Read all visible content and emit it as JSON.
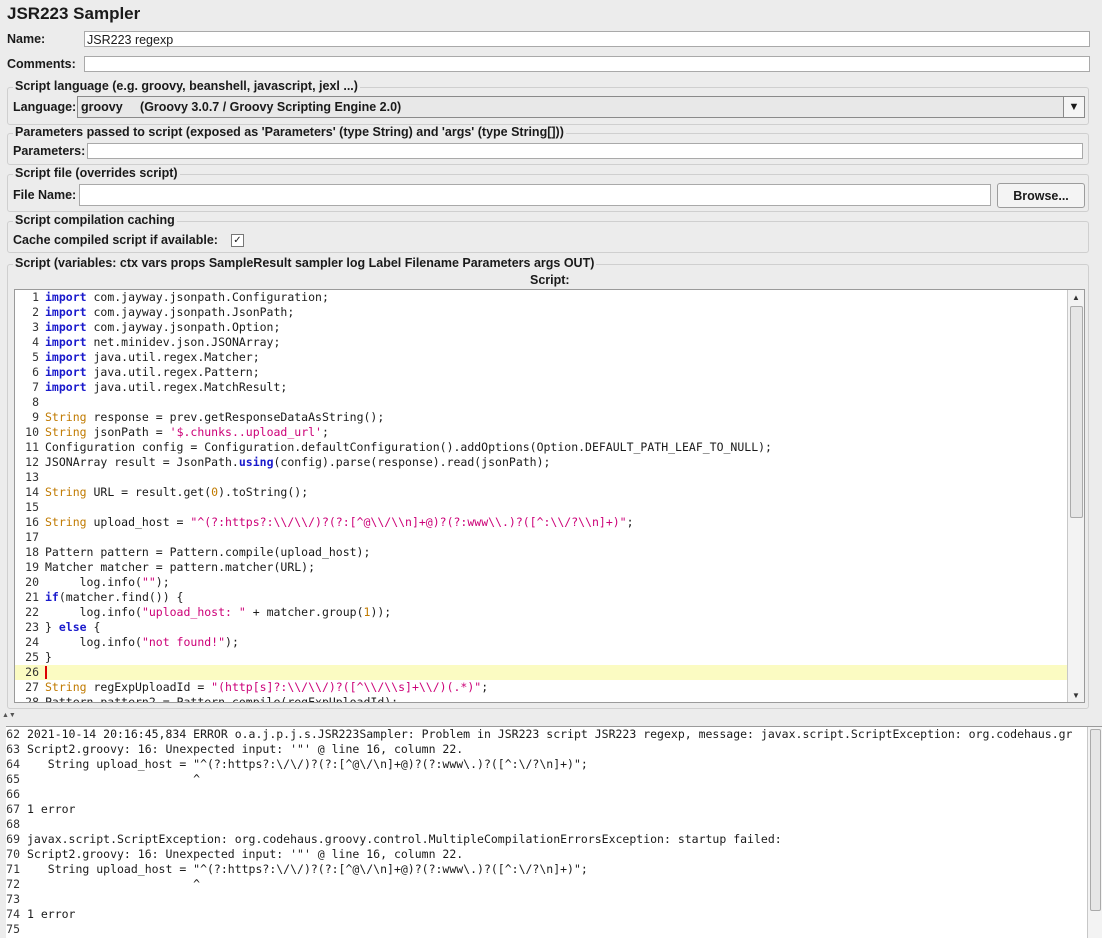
{
  "title": "JSR223 Sampler",
  "name_label": "Name:",
  "name_value": "JSR223 regexp",
  "comments_label": "Comments:",
  "comments_value": "",
  "script_language": {
    "group_title": "Script language (e.g. groovy, beanshell, javascript, jexl ...)",
    "label": "Language:",
    "selected": "groovy     (Groovy 3.0.7 / Groovy Scripting Engine 2.0)"
  },
  "parameters": {
    "group_title": "Parameters passed to script (exposed as 'Parameters' (type String) and 'args' (type String[]))",
    "label": "Parameters:",
    "value": ""
  },
  "script_file": {
    "group_title": "Script file (overrides script)",
    "label": "File Name:",
    "value": "",
    "browse_label": "Browse..."
  },
  "caching": {
    "group_title": "Script compilation caching",
    "label": "Cache compiled script if available:",
    "checked": true,
    "check_glyph": "✓"
  },
  "script": {
    "group_title": "Script (variables: ctx vars props SampleResult sampler log Label Filename Parameters args OUT)",
    "header": "Script:",
    "current_line": 26,
    "lines": [
      {
        "n": "1",
        "html": "<span class=\"kw\">import</span> com.jayway.jsonpath.Configuration;"
      },
      {
        "n": "2",
        "html": "<span class=\"kw\">import</span> com.jayway.jsonpath.JsonPath;"
      },
      {
        "n": "3",
        "html": "<span class=\"kw\">import</span> com.jayway.jsonpath.Option;"
      },
      {
        "n": "4",
        "html": "<span class=\"kw\">import</span> net.minidev.json.JSONArray;"
      },
      {
        "n": "5",
        "html": "<span class=\"kw\">import</span> java.util.regex.Matcher;"
      },
      {
        "n": "6",
        "html": "<span class=\"kw\">import</span> java.util.regex.Pattern;"
      },
      {
        "n": "7",
        "html": "<span class=\"kw\">import</span> java.util.regex.MatchResult;"
      },
      {
        "n": "8",
        "html": ""
      },
      {
        "n": "9",
        "html": "<span class=\"ty\">String</span> response = prev.getResponseDataAsString();"
      },
      {
        "n": "10",
        "html": "<span class=\"ty\">String</span> jsonPath = <span class=\"st\">'$.chunks..upload_url'</span>;"
      },
      {
        "n": "11",
        "html": "Configuration config = Configuration.defaultConfiguration().addOptions(Option.DEFAULT_PATH_LEAF_TO_NULL);"
      },
      {
        "n": "12",
        "html": "JSONArray result = JsonPath.<span class=\"kw\">using</span>(config).parse(response).read(jsonPath);"
      },
      {
        "n": "13",
        "html": ""
      },
      {
        "n": "14",
        "html": "<span class=\"ty\">String</span> URL = result.get(<span class=\"nm\">0</span>).toString();"
      },
      {
        "n": "15",
        "html": ""
      },
      {
        "n": "16",
        "html": "<span class=\"ty\">String</span> upload_host = <span class=\"st\">\"^(?:https?:\\\\/\\\\/)?(?:[^@\\\\/\\\\n]+@)?(?:www\\\\.)?([^:\\\\/?\\\\n]+)\"</span>;"
      },
      {
        "n": "17",
        "html": ""
      },
      {
        "n": "18",
        "html": "Pattern pattern = Pattern.compile(upload_host);"
      },
      {
        "n": "19",
        "html": "Matcher matcher = pattern.matcher(URL);"
      },
      {
        "n": "20",
        "html": "     log.info(<span class=\"st\">\"\"</span>);"
      },
      {
        "n": "21",
        "html": "<span class=\"kw\">if</span>(matcher.find()) {"
      },
      {
        "n": "22",
        "html": "     log.info(<span class=\"st\">\"upload_host: \"</span> + matcher.group(<span class=\"nm\">1</span>));"
      },
      {
        "n": "23",
        "html": "} <span class=\"kw\">else</span> {"
      },
      {
        "n": "24",
        "html": "     log.info(<span class=\"st\">\"not found!\"</span>);"
      },
      {
        "n": "25",
        "html": "}"
      },
      {
        "n": "26",
        "html": ""
      },
      {
        "n": "27",
        "html": "<span class=\"ty\">String</span> regExpUploadId = <span class=\"st\">\"(http[s]?:\\\\/\\\\/)?([^\\\\/\\\\s]+\\\\/)(.*)\"</span>;"
      },
      {
        "n": "28",
        "html": "Pattern pattern2 = Pattern.compile(regExpUploadId);"
      }
    ]
  },
  "log": {
    "lines": [
      {
        "n": "62",
        "t": "2021-10-14 20:16:45,834 ERROR o.a.j.p.j.s.JSR223Sampler: Problem in JSR223 script JSR223 regexp, message: javax.script.ScriptException: org.codehaus.gr"
      },
      {
        "n": "63",
        "t": "Script2.groovy: 16: Unexpected input: '\"' @ line 16, column 22."
      },
      {
        "n": "64",
        "t": "   String upload_host = \"^(?:https?:\\/\\/)?(?:[^@\\/\\n]+@)?(?:www\\.)?([^:\\/?\\n]+)\";"
      },
      {
        "n": "65",
        "t": "                        ^"
      },
      {
        "n": "66",
        "t": ""
      },
      {
        "n": "67",
        "t": "1 error"
      },
      {
        "n": "68",
        "t": ""
      },
      {
        "n": "69",
        "t": "javax.script.ScriptException: org.codehaus.groovy.control.MultipleCompilationErrorsException: startup failed:"
      },
      {
        "n": "70",
        "t": "Script2.groovy: 16: Unexpected input: '\"' @ line 16, column 22."
      },
      {
        "n": "71",
        "t": "   String upload_host = \"^(?:https?:\\/\\/)?(?:[^@\\/\\n]+@)?(?:www\\.)?([^:\\/?\\n]+)\";"
      },
      {
        "n": "72",
        "t": "                        ^"
      },
      {
        "n": "73",
        "t": ""
      },
      {
        "n": "74",
        "t": "1 error"
      },
      {
        "n": "75",
        "t": ""
      }
    ]
  }
}
